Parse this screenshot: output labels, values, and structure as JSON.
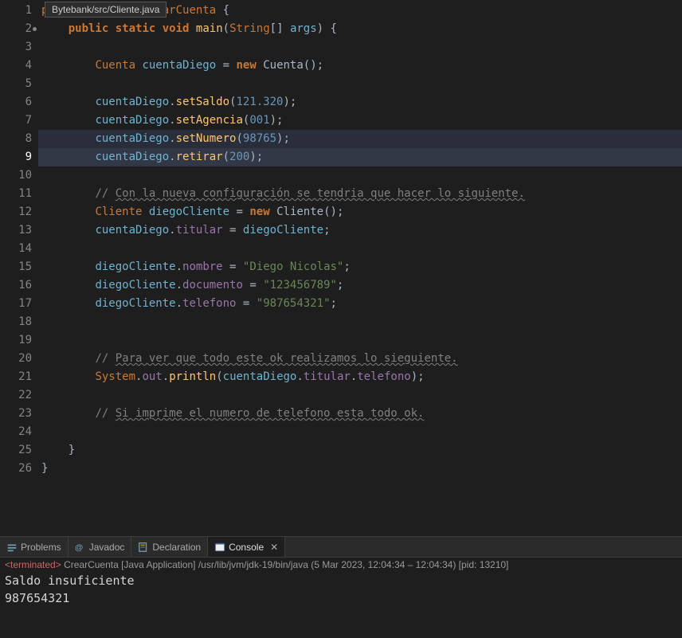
{
  "tooltip": "Bytebank/src/Cliente.java",
  "gutter": {
    "lines": [
      1,
      2,
      3,
      4,
      5,
      6,
      7,
      8,
      9,
      10,
      11,
      12,
      13,
      14,
      15,
      16,
      17,
      18,
      19,
      20,
      21,
      22,
      23,
      24,
      25,
      26
    ],
    "current": 9,
    "dirty": [
      2
    ]
  },
  "code": {
    "l1": {
      "p1": "p",
      "kw1": "arCuenta",
      "p2": " {"
    },
    "l2": {
      "kw_public": "public",
      "kw_static": "static",
      "kw_void": "void",
      "main": "main",
      "str_t": "String",
      "args": "args",
      "brace": "{"
    },
    "l4": {
      "cls": "Cuenta",
      "var": "cuentaDiego",
      "eq": "=",
      "new": "new",
      "cls2": "Cuenta"
    },
    "l6": {
      "var": "cuentaDiego",
      "m": "setSaldo",
      "n": "121.320"
    },
    "l7": {
      "var": "cuentaDiego",
      "m": "setAgencia",
      "n": "001"
    },
    "l8": {
      "var": "cuentaDiego",
      "m": "setNumero",
      "n": "98765"
    },
    "l9": {
      "var": "cuentaDiego",
      "m": "retirar",
      "n": "200"
    },
    "l11": {
      "c": "//",
      "t": "Con la nueva configuración se tendria que hacer lo siguiente."
    },
    "l12": {
      "cls": "Cliente",
      "var": "diegoCliente",
      "eq": "=",
      "new": "new",
      "cls2": "Cliente"
    },
    "l13": {
      "var": "cuentaDiego",
      "f": "titular",
      "eq": "=",
      "var2": "diegoCliente"
    },
    "l15": {
      "var": "diegoCliente",
      "f": "nombre",
      "eq": "=",
      "s": "\"Diego Nicolas\""
    },
    "l16": {
      "var": "diegoCliente",
      "f": "documento",
      "eq": "=",
      "s": "\"123456789\""
    },
    "l17": {
      "var": "diegoCliente",
      "f": "telefono",
      "eq": "=",
      "s": "\"987654321\""
    },
    "l20": {
      "c": "//",
      "t": "Para ver que todo este ok realizamos lo sieguiente."
    },
    "l21": {
      "sys": "System",
      "out": "out",
      "pl": "println",
      "var": "cuentaDiego",
      "f1": "titular",
      "f2": "telefono"
    },
    "l23": {
      "c": "//",
      "t": "Si imprime el numero de telefono esta todo ok."
    },
    "l25": {
      "b": "}"
    },
    "l26": {
      "b": "}"
    }
  },
  "tabs": {
    "problems": "Problems",
    "javadoc": "Javadoc",
    "declaration": "Declaration",
    "console": "Console"
  },
  "console": {
    "status_prefix": "<terminated>",
    "status_main": "CrearCuenta [Java Application] /usr/lib/jvm/jdk-19/bin/java  (5 Mar 2023, 12:04:34 – 12:04:34) [pid: 13210]",
    "out1": "Saldo insuficiente",
    "out2": "987654321"
  }
}
